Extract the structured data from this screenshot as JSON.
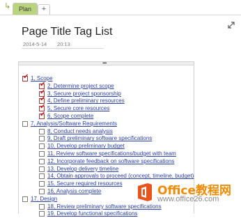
{
  "tabs": [
    {
      "label": "Plan",
      "active": true
    },
    {
      "label": "+",
      "active": false
    }
  ],
  "page": {
    "title": "Page Title Tag List",
    "date": "2014-5-14",
    "time": "20:13"
  },
  "tasks": [
    {
      "label": "1, Scope",
      "checked": true,
      "indent": 0
    },
    {
      "label": "2, Determine project scope",
      "checked": true,
      "indent": 1
    },
    {
      "label": "3, Secure project sponsorship",
      "checked": true,
      "indent": 1
    },
    {
      "label": "4, Define preliminary resources",
      "checked": true,
      "indent": 1
    },
    {
      "label": "5, Secure core resources",
      "checked": true,
      "indent": 1
    },
    {
      "label": "6, Scope complete",
      "checked": true,
      "indent": 1
    },
    {
      "label": "7, Analysis/Software Requirements",
      "checked": false,
      "indent": 0
    },
    {
      "label": "8, Conduct needs analysis",
      "checked": false,
      "indent": 1
    },
    {
      "label": "9, Draft preliminary software specifications",
      "checked": false,
      "indent": 1
    },
    {
      "label": "10, Develop preliminary budget",
      "checked": false,
      "indent": 1
    },
    {
      "label": "11, Review software specifications/budget with team",
      "checked": false,
      "indent": 1
    },
    {
      "label": "12, Incorporate feedback on software specifications",
      "checked": false,
      "indent": 1
    },
    {
      "label": "13, Develop delivery timeline",
      "checked": false,
      "indent": 1
    },
    {
      "label": "14, Obtain approvals to proceed (concept, timeline, budget)",
      "checked": false,
      "indent": 1
    },
    {
      "label": "15, Secure required resources",
      "checked": false,
      "indent": 1
    },
    {
      "label": "16, Analysis complete",
      "checked": false,
      "indent": 1
    },
    {
      "label": "17, Design",
      "checked": false,
      "indent": 0
    },
    {
      "label": "18, Review preliminary software specifications",
      "checked": false,
      "indent": 1
    },
    {
      "label": "19, Develop functional specifications",
      "checked": false,
      "indent": 1
    }
  ],
  "watermark": {
    "title": "Office教程网",
    "url": "www.office26.com"
  },
  "colors": {
    "active_tab": "#b9d47a",
    "link": "#2a3fa6",
    "checkmark": "#c32121",
    "watermark_orange": "#f08a00"
  }
}
